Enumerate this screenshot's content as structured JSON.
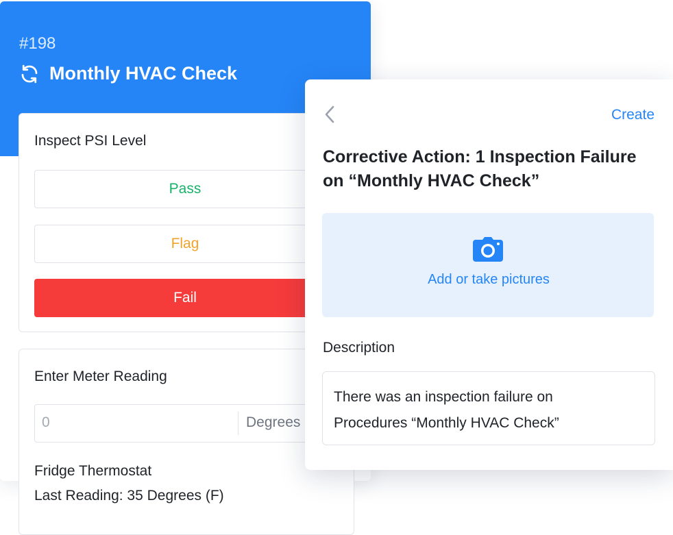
{
  "procedure": {
    "number": "#198",
    "title": "Monthly HVAC Check",
    "icon": "refresh-icon",
    "accent_color": "#2585f7"
  },
  "psi_field": {
    "label": "Inspect PSI Level",
    "options": [
      {
        "label": "Pass",
        "color": "#17b26a"
      },
      {
        "label": "Flag",
        "color": "#f1a32a"
      },
      {
        "label": "Fail",
        "color": "#f63b3b",
        "selected": true
      }
    ]
  },
  "meter_field": {
    "label": "Enter Meter Reading",
    "placeholder": "0",
    "unit": "Degrees",
    "meter_name": "Fridge Thermostat",
    "last_reading": "Last Reading: 35 Degrees (F)"
  },
  "corrective_action": {
    "back_icon": "chevron-left-icon",
    "create_label": "Create",
    "title": "Corrective Action: 1 Inspection Failure on “Monthly HVAC Check”",
    "photo_icon": "camera-icon",
    "photo_label": "Add or take pictures",
    "description_label": "Description",
    "description_lines": [
      "There was an inspection failure on",
      "Procedures “Monthly HVAC Check”"
    ]
  }
}
